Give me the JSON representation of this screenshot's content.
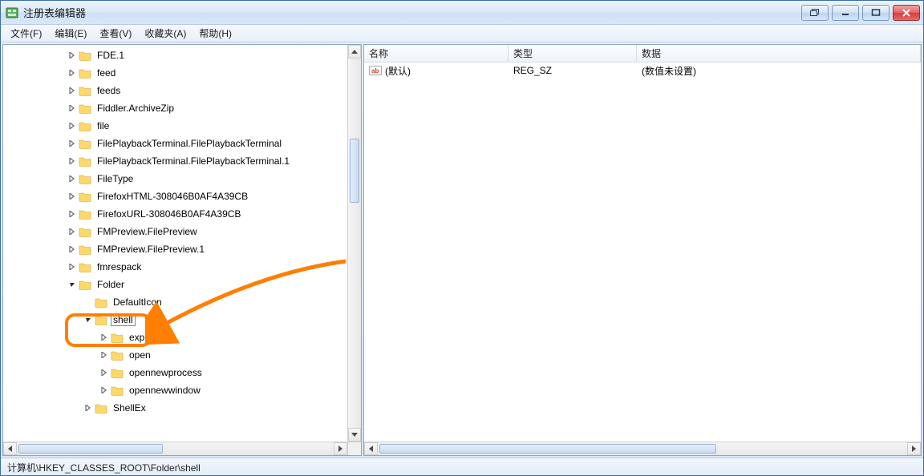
{
  "window": {
    "title": "注册表编辑器"
  },
  "menu": {
    "file": "文件(F)",
    "edit": "编辑(E)",
    "view": "查看(V)",
    "favorites": "收藏夹(A)",
    "help": "帮助(H)"
  },
  "tree": {
    "items": [
      {
        "indent": 3,
        "exp": "closed",
        "label": "FDE.1"
      },
      {
        "indent": 3,
        "exp": "closed",
        "label": "feed"
      },
      {
        "indent": 3,
        "exp": "closed",
        "label": "feeds"
      },
      {
        "indent": 3,
        "exp": "closed",
        "label": "Fiddler.ArchiveZip"
      },
      {
        "indent": 3,
        "exp": "closed",
        "label": "file"
      },
      {
        "indent": 3,
        "exp": "closed",
        "label": "FilePlaybackTerminal.FilePlaybackTerminal"
      },
      {
        "indent": 3,
        "exp": "closed",
        "label": "FilePlaybackTerminal.FilePlaybackTerminal.1"
      },
      {
        "indent": 3,
        "exp": "closed",
        "label": "FileType"
      },
      {
        "indent": 3,
        "exp": "closed",
        "label": "FirefoxHTML-308046B0AF4A39CB"
      },
      {
        "indent": 3,
        "exp": "closed",
        "label": "FirefoxURL-308046B0AF4A39CB"
      },
      {
        "indent": 3,
        "exp": "closed",
        "label": "FMPreview.FilePreview"
      },
      {
        "indent": 3,
        "exp": "closed",
        "label": "FMPreview.FilePreview.1"
      },
      {
        "indent": 3,
        "exp": "closed",
        "label": "fmrespack"
      },
      {
        "indent": 3,
        "exp": "open",
        "label": "Folder"
      },
      {
        "indent": 4,
        "exp": "none",
        "label": "DefaultIcon"
      },
      {
        "indent": 4,
        "exp": "open",
        "label": "shell",
        "selected": true
      },
      {
        "indent": 5,
        "exp": "closed",
        "label": "explore"
      },
      {
        "indent": 5,
        "exp": "closed",
        "label": "open"
      },
      {
        "indent": 5,
        "exp": "closed",
        "label": "opennewprocess"
      },
      {
        "indent": 5,
        "exp": "closed",
        "label": "opennewwindow"
      },
      {
        "indent": 4,
        "exp": "closed",
        "label": "ShellEx"
      }
    ]
  },
  "list": {
    "headers": {
      "name": "名称",
      "type": "类型",
      "data": "数据"
    },
    "col_widths": {
      "name": 180,
      "type": 160,
      "data": 300
    },
    "rows": [
      {
        "name": "(默认)",
        "type": "REG_SZ",
        "data": "(数值未设置)"
      }
    ]
  },
  "statusbar": {
    "path": "计算机\\HKEY_CLASSES_ROOT\\Folder\\shell"
  }
}
